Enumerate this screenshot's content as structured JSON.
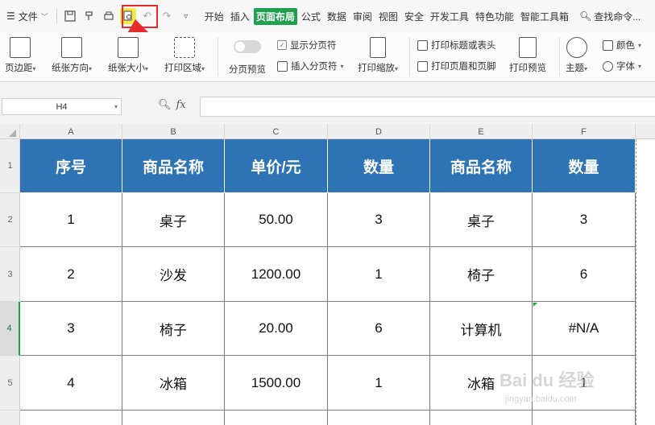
{
  "menubar": {
    "file_label": "文件",
    "tabs": [
      {
        "label": "开始"
      },
      {
        "label": "插入"
      },
      {
        "label": "页面布局",
        "active": true
      },
      {
        "label": "公式"
      },
      {
        "label": "数据"
      },
      {
        "label": "审阅"
      },
      {
        "label": "视图"
      },
      {
        "label": "安全"
      },
      {
        "label": "开发工具"
      },
      {
        "label": "特色功能"
      },
      {
        "label": "智能工具箱"
      }
    ],
    "search_label": "查找命令..."
  },
  "ribbon": {
    "margins": "页边距",
    "orientation": "纸张方向",
    "size": "纸张大小",
    "print_area": "打印区域",
    "page_break_preview": "分页预览",
    "show_page_breaks": "显示分页符",
    "insert_page_break": "插入分页符",
    "print_scaling": "打印缩放",
    "print_titles": "打印标题或表头",
    "header_footer": "打印页眉和页脚",
    "print_preview": "打印预览",
    "theme": "主题",
    "colors": "颜色",
    "fonts": "字体"
  },
  "formula_bar": {
    "name_box": "H4",
    "fx": "fx",
    "formula": ""
  },
  "grid": {
    "columns": [
      "A",
      "B",
      "C",
      "D",
      "E",
      "F"
    ],
    "rows": [
      "1",
      "2",
      "3",
      "4",
      "5"
    ],
    "header": [
      "序号",
      "商品名称",
      "单价/元",
      "数量",
      "商品名称",
      "数量"
    ],
    "data": [
      [
        "1",
        "桌子",
        "50.00",
        "3",
        "桌子",
        "3"
      ],
      [
        "2",
        "沙发",
        "1200.00",
        "1",
        "椅子",
        "6"
      ],
      [
        "3",
        "椅子",
        "20.00",
        "6",
        "计算机",
        "#N/A"
      ],
      [
        "4",
        "冰箱",
        "1500.00",
        "1",
        "冰箱",
        "1"
      ]
    ]
  },
  "colors": {
    "header_fill": "#2e74b5",
    "active_tab": "#1fa04f",
    "highlight": "#e52b2b"
  },
  "watermark": {
    "main": "Bai du 经验",
    "sub": "jingyan.baidu.com"
  }
}
